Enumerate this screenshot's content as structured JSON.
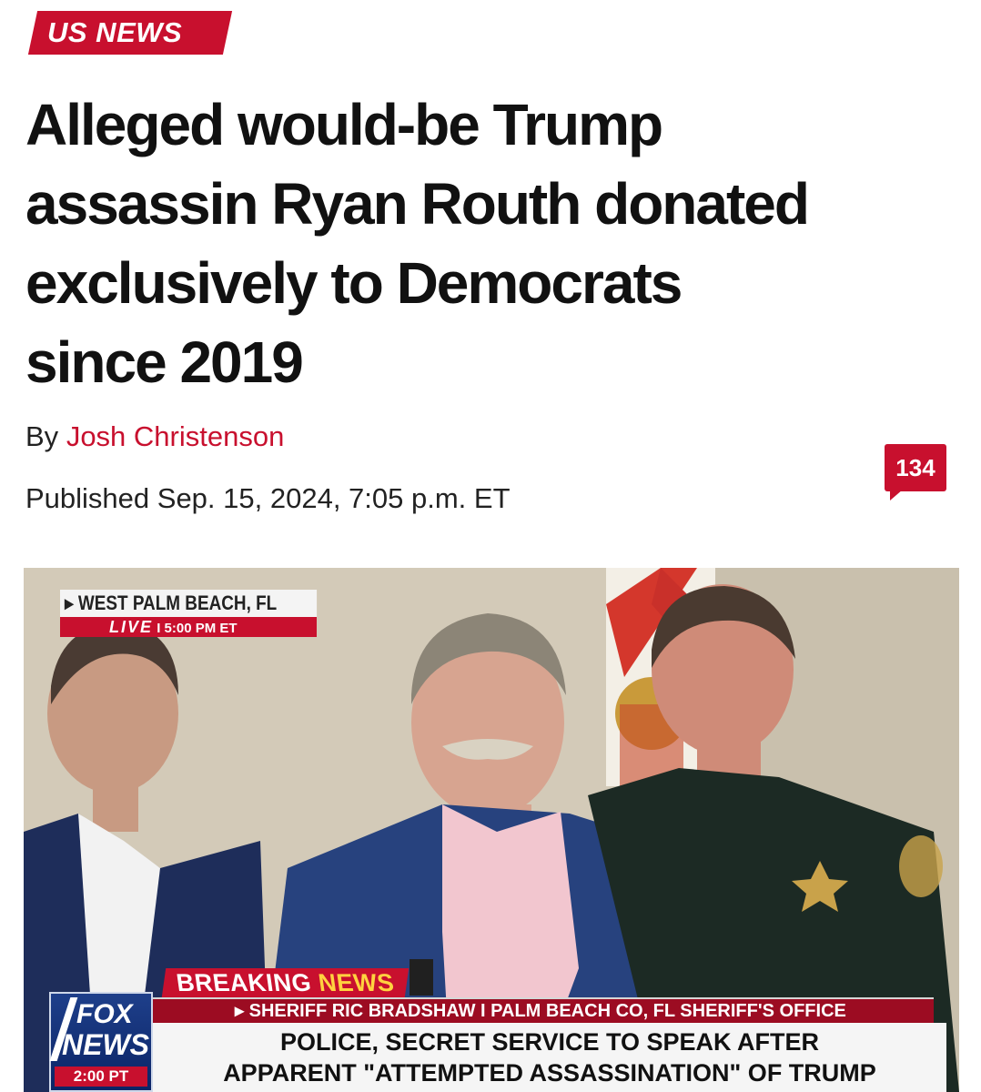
{
  "category": "US NEWS",
  "headline": {
    "line1": "Alleged would-be Trump",
    "line2": "assassin Ryan Routh donated",
    "line3": "exclusively to Democrats",
    "line4": "since 2019"
  },
  "byline": {
    "prefix": "By",
    "author": "Josh Christenson"
  },
  "published": "Published Sep. 15, 2024, 7:05 p.m. ET",
  "comments": {
    "count": "134",
    "icon": "comment-bubble-icon"
  },
  "image": {
    "location": "WEST PALM BEACH, FL",
    "live_label": "LIVE",
    "live_separator": "I",
    "live_time": "5:00 PM ET",
    "breaking_word1": "BREAKING",
    "breaking_word2": "NEWS",
    "speaker_strip": "SHERIFF RIC BRADSHAW I PALM BEACH CO, FL SHERIFF'S OFFICE",
    "headline_line1": "POLICE, SECRET SERVICE TO SPEAK AFTER",
    "headline_line2": "APPARENT \"ATTEMPTED ASSASSINATION\" OF TRUMP",
    "logo_fox": "FOX",
    "logo_news": "NEWS",
    "logo_time": "2:00 PT"
  },
  "colors": {
    "accent": "#c8102e",
    "text": "#111111",
    "fox_blue": "#0b2466"
  }
}
